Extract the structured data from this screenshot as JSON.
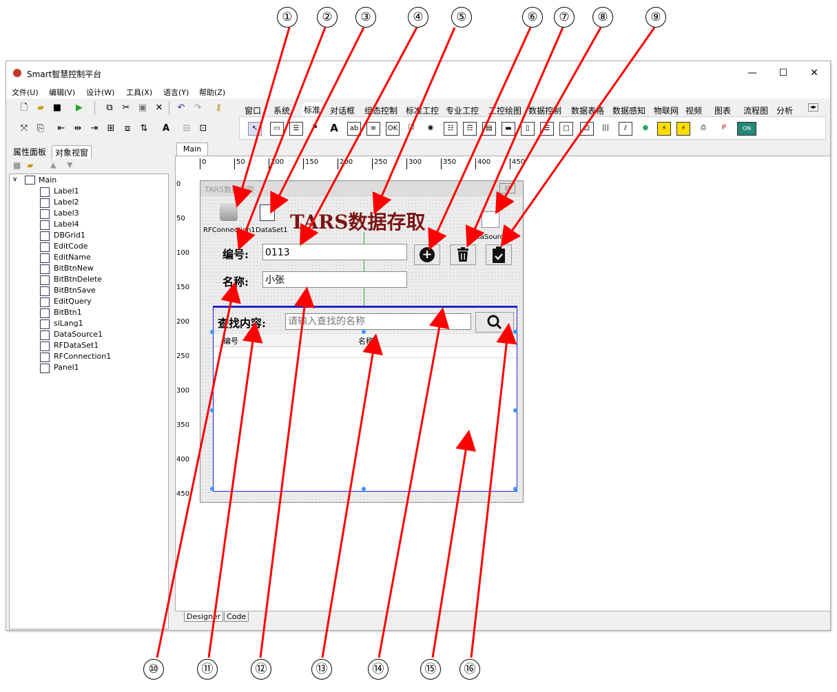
{
  "window": {
    "title": "Smart智慧控制平台",
    "minimize": "—",
    "maximize": "☐",
    "close": "✕"
  },
  "menu": [
    "文件(U)",
    "编辑(V)",
    "设计(W)",
    "工具(X)",
    "语言(Y)",
    "帮助(Z)"
  ],
  "palette_tabs": [
    "窗口",
    "系统",
    "标准",
    "对话框",
    "组态控制",
    "标准工控",
    "专业工控",
    "工控绘图",
    "数据控制",
    "数据表格",
    "数据感知",
    "物联网",
    "视频",
    "图表",
    "流程图",
    "分析"
  ],
  "left_tabs": [
    "属性面板",
    "对象视窗"
  ],
  "tree": {
    "root": "Main",
    "items": [
      "Label1",
      "Label2",
      "Label3",
      "Label4",
      "DBGrid1",
      "EditCode",
      "EditName",
      "BitBtnNew",
      "BitBtnDelete",
      "BitBtnSave",
      "EditQuery",
      "BitBtn1",
      "siLang1",
      "DataSource1",
      "RFDataSet1",
      "RFConnection1",
      "Panel1"
    ]
  },
  "designer": {
    "tab": "Main",
    "bottom_tabs": [
      "Designer",
      "Code"
    ]
  },
  "ruler": {
    "top": [
      "0",
      "50",
      "100",
      "150",
      "200",
      "250",
      "300",
      "350",
      "400",
      "450"
    ],
    "left": [
      "0",
      "50",
      "100",
      "150",
      "200",
      "250",
      "300",
      "350",
      "400",
      "450"
    ]
  },
  "form": {
    "title": "TARS数据存取",
    "close": "⊠",
    "components": {
      "conn": "RFConnection1",
      "dataset": "DataSet1",
      "datasource": "DataSource1"
    },
    "heading": "TARS数据存取",
    "code_label": "编号:",
    "code_value": "0113",
    "name_label": "名称:",
    "name_value": "小张",
    "query_label": "查找内容:",
    "query_placeholder": "请输入查找的名称",
    "grid_columns": [
      "编号",
      "名称"
    ]
  },
  "annotations": [
    "①",
    "②",
    "③",
    "④",
    "⑤",
    "⑥",
    "⑦",
    "⑧",
    "⑨",
    "⑩",
    "⑪",
    "⑫",
    "⑬",
    "⑭",
    "⑮",
    "⑯"
  ],
  "colors": {
    "arrow": "#ff0000",
    "heading": "#7b1414",
    "grid_border": "#2222cc"
  }
}
